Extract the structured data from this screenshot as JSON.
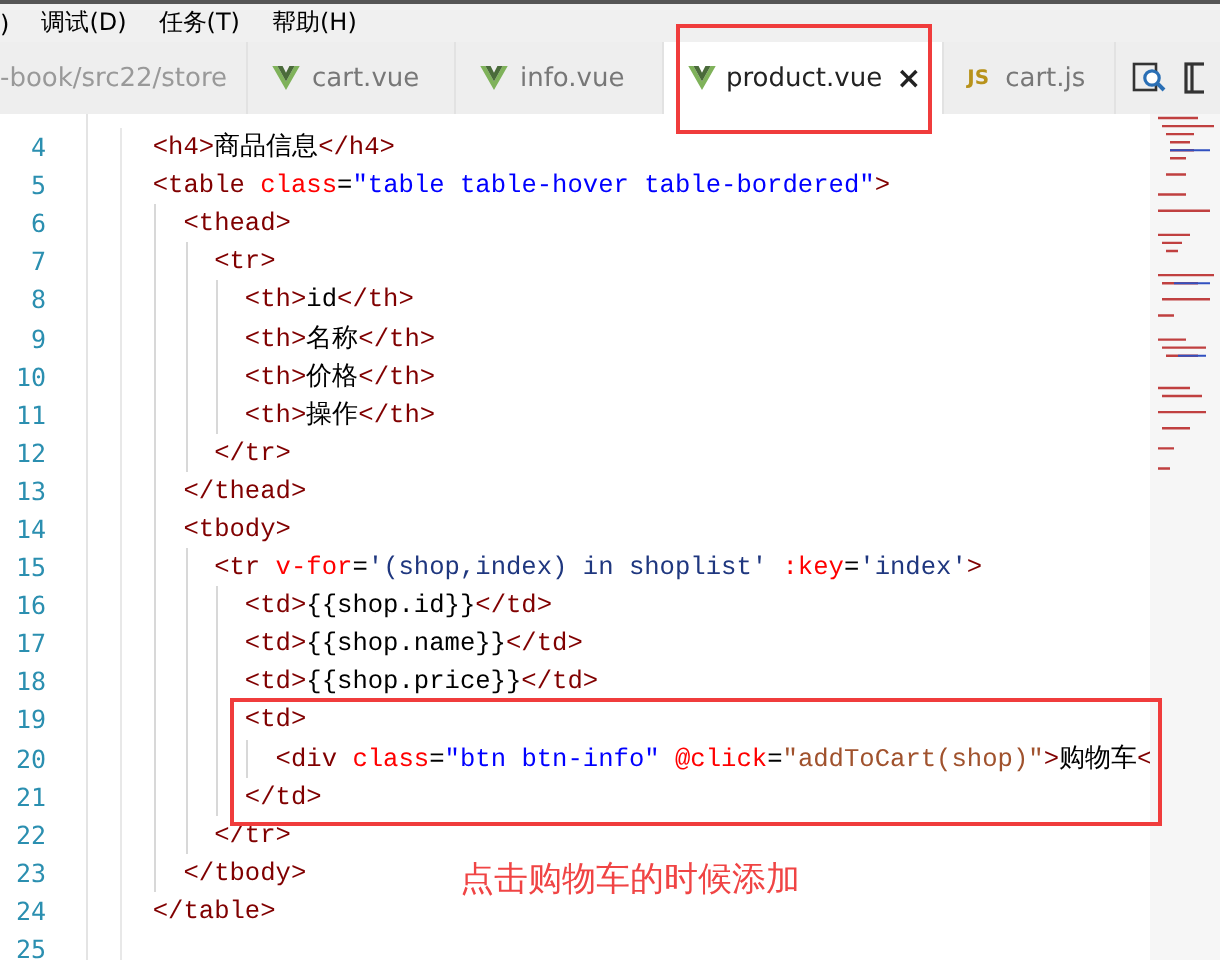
{
  "menu": [
    {
      "label": ")"
    },
    {
      "label": "调试(D)"
    },
    {
      "label": "任务(T)"
    },
    {
      "label": "帮助(H)"
    }
  ],
  "tabs": [
    {
      "kind": "path",
      "label": "-book/src22/store",
      "selected": false
    },
    {
      "kind": "vue",
      "label": "cart.vue",
      "selected": false
    },
    {
      "kind": "vue",
      "label": "info.vue",
      "selected": false
    },
    {
      "kind": "vue",
      "label": "product.vue",
      "selected": true,
      "close": "×"
    },
    {
      "kind": "js",
      "label": "cart.js",
      "selected": false,
      "badge": "JS"
    }
  ],
  "editor": {
    "lines": [
      {
        "number": "4",
        "tokens": [
          {
            "kind": "tag",
            "s": "  <h4>"
          },
          {
            "kind": "text",
            "s": "商品信息"
          },
          {
            "kind": "tag",
            "s": "</h4>"
          }
        ]
      },
      {
        "number": "5",
        "tokens": [
          {
            "kind": "tag",
            "s": "  <table "
          },
          {
            "kind": "attr",
            "s": "class"
          },
          {
            "kind": "text",
            "s": "="
          },
          {
            "kind": "string",
            "s": "\"table table-hover table-bordered\""
          },
          {
            "kind": "tag",
            "s": ">"
          }
        ]
      },
      {
        "number": "6",
        "tokens": [
          {
            "kind": "tag",
            "s": "    <thead>"
          }
        ]
      },
      {
        "number": "7",
        "tokens": [
          {
            "kind": "tag",
            "s": "      <tr>"
          }
        ]
      },
      {
        "number": "8",
        "tokens": [
          {
            "kind": "tag",
            "s": "        <th>"
          },
          {
            "kind": "text",
            "s": "id"
          },
          {
            "kind": "tag",
            "s": "</th>"
          }
        ]
      },
      {
        "number": "9",
        "tokens": [
          {
            "kind": "tag",
            "s": "        <th>"
          },
          {
            "kind": "text",
            "s": "名称"
          },
          {
            "kind": "tag",
            "s": "</th>"
          }
        ]
      },
      {
        "number": "10",
        "tokens": [
          {
            "kind": "tag",
            "s": "        <th>"
          },
          {
            "kind": "text",
            "s": "价格"
          },
          {
            "kind": "tag",
            "s": "</th>"
          }
        ]
      },
      {
        "number": "11",
        "tokens": [
          {
            "kind": "tag",
            "s": "        <th>"
          },
          {
            "kind": "text",
            "s": "操作"
          },
          {
            "kind": "tag",
            "s": "</th>"
          }
        ]
      },
      {
        "number": "12",
        "tokens": [
          {
            "kind": "tag",
            "s": "      </tr>"
          }
        ]
      },
      {
        "number": "13",
        "tokens": [
          {
            "kind": "tag",
            "s": "    </thead>"
          }
        ]
      },
      {
        "number": "14",
        "tokens": [
          {
            "kind": "tag",
            "s": "    <tbody>"
          }
        ]
      },
      {
        "number": "15",
        "tokens": [
          {
            "kind": "tag",
            "s": "      <tr "
          },
          {
            "kind": "attr",
            "s": "v-for"
          },
          {
            "kind": "text",
            "s": "="
          },
          {
            "kind": "vstring",
            "s": "'(shop,index) in shoplist' "
          },
          {
            "kind": "attr",
            "s": ":key"
          },
          {
            "kind": "text",
            "s": "="
          },
          {
            "kind": "vstring",
            "s": "'index'"
          },
          {
            "kind": "tag",
            "s": ">"
          }
        ]
      },
      {
        "number": "16",
        "tokens": [
          {
            "kind": "tag",
            "s": "        <td>"
          },
          {
            "kind": "text",
            "s": "{{shop.id}}"
          },
          {
            "kind": "tag",
            "s": "</td>"
          }
        ]
      },
      {
        "number": "17",
        "tokens": [
          {
            "kind": "tag",
            "s": "        <td>"
          },
          {
            "kind": "text",
            "s": "{{shop.name}}"
          },
          {
            "kind": "tag",
            "s": "</td>"
          }
        ]
      },
      {
        "number": "18",
        "tokens": [
          {
            "kind": "tag",
            "s": "        <td>"
          },
          {
            "kind": "text",
            "s": "{{shop.price}}"
          },
          {
            "kind": "tag",
            "s": "</td>"
          }
        ]
      },
      {
        "number": "19",
        "tokens": [
          {
            "kind": "tag",
            "s": "        <td>"
          }
        ]
      },
      {
        "number": "20",
        "tokens": [
          {
            "kind": "tag",
            "s": "          <div "
          },
          {
            "kind": "attr",
            "s": "class"
          },
          {
            "kind": "text",
            "s": "="
          },
          {
            "kind": "string",
            "s": "\"btn btn-info\" "
          },
          {
            "kind": "attr",
            "s": "@click"
          },
          {
            "kind": "text",
            "s": "="
          },
          {
            "kind": "fstring",
            "s": "\"addToCart(shop)\""
          },
          {
            "kind": "tag",
            "s": ">"
          },
          {
            "kind": "text",
            "s": "购物车"
          },
          {
            "kind": "tag",
            "s": "<"
          }
        ]
      },
      {
        "number": "21",
        "tokens": [
          {
            "kind": "tag",
            "s": "        </td>"
          }
        ]
      },
      {
        "number": "22",
        "tokens": [
          {
            "kind": "tag",
            "s": "      </tr>"
          }
        ]
      },
      {
        "number": "23",
        "tokens": [
          {
            "kind": "tag",
            "s": "    </tbody>"
          }
        ]
      },
      {
        "number": "24",
        "tokens": [
          {
            "kind": "tag",
            "s": "  </table>"
          }
        ]
      },
      {
        "number": "25"
      }
    ]
  },
  "annotation": "点击购物车的时候添加"
}
